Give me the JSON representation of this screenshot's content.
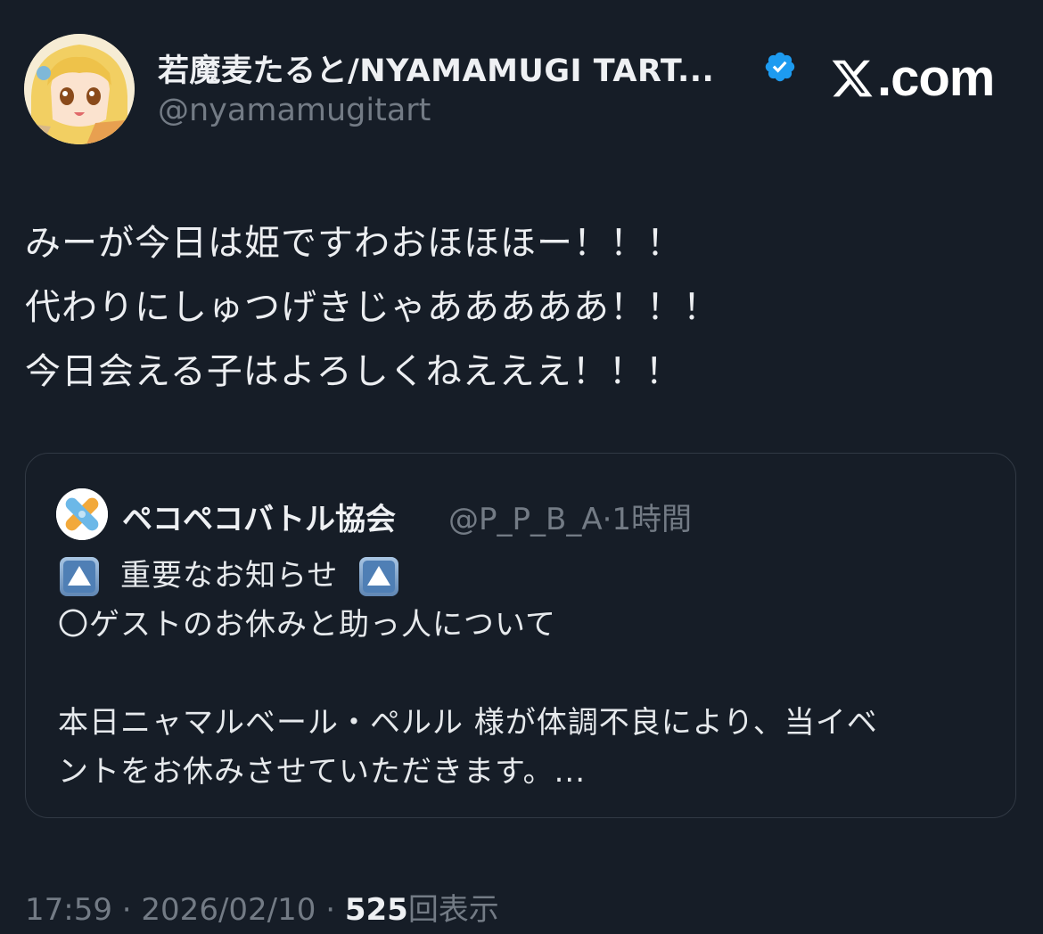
{
  "author": {
    "display_name": "若魔麦たると/NYAMAMUGI TART...",
    "handle": "@nyamamugitart",
    "verified": true,
    "avatar_icon": "anime-girl-avatar"
  },
  "brand": {
    "icon": "x-logo-icon",
    "text": ".com"
  },
  "tweet": {
    "lines": [
      "みーが今日は姫ですわおほほほー！！！",
      "代わりにしゅつげきじゃあああああ！！！",
      "今日会える子はよろしくねえええ！！！"
    ]
  },
  "quote": {
    "display_name": "ペコペコバトル協会",
    "handle": "@P_P_B_A",
    "separator": "·",
    "time": "1時間",
    "emoji_icon": "up-arrow-button-icon",
    "title": "重要なお知らせ",
    "subtitle": "〇ゲストのお休みと助っ人について",
    "body_line1": "本日ニャマルベール・ペルル 様が体調不良により、当イベ",
    "body_line2": "ントをお休みさせていただきます。..."
  },
  "meta": {
    "time": "17:59",
    "sep1": " · ",
    "date": "2026/02/10",
    "sep2": " · ",
    "views": "525",
    "views_label": "回表示"
  },
  "colors": {
    "background": "#161d27",
    "text": "#eef0f3",
    "muted": "#737b85",
    "verified": "#1d9bf0",
    "border": "#313944"
  }
}
